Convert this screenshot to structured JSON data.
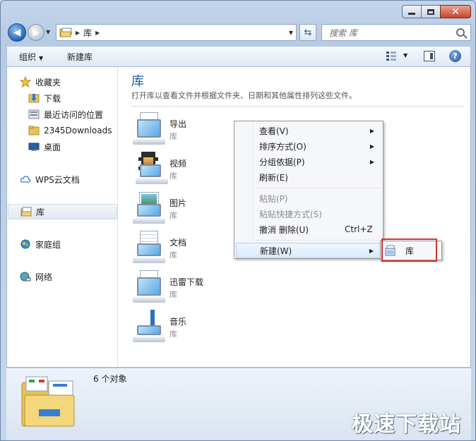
{
  "window": {
    "caption_buttons": [
      "minimize",
      "maximize",
      "close"
    ]
  },
  "navbar": {
    "address_path": [
      "库"
    ],
    "search_placeholder": "搜索 库"
  },
  "cmdbar": {
    "organize": "组织",
    "new_library": "新建库"
  },
  "navpane": {
    "favorites": "收藏夹",
    "downloads": "下载",
    "recent": "最近访问的位置",
    "downloads2345": "2345Downloads",
    "desktop": "桌面",
    "wps": "WPS云文档",
    "libraries": "库",
    "homegroup": "家庭组",
    "network": "网络"
  },
  "main": {
    "title": "库",
    "subtitle": "打开库以查看文件并根据文件夹、日期和其他属性排列这些文件。",
    "items": [
      {
        "name": "导出",
        "kind": "库",
        "icon": "monitor-icon"
      },
      {
        "name": "视频",
        "kind": "库",
        "icon": "video-icon"
      },
      {
        "name": "图片",
        "kind": "库",
        "icon": "pictures-icon"
      },
      {
        "name": "文档",
        "kind": "库",
        "icon": "documents-icon"
      },
      {
        "name": "迅雷下载",
        "kind": "库",
        "icon": "monitor-icon"
      },
      {
        "name": "音乐",
        "kind": "库",
        "icon": "music-icon"
      }
    ]
  },
  "context_menu": {
    "view": "查看(V)",
    "sort": "排序方式(O)",
    "group": "分组依据(P)",
    "refresh": "刷新(E)",
    "paste": "粘贴(P)",
    "paste_shortcut": "粘贴快捷方式(S)",
    "undo": "撤消 删除(U)",
    "undo_shortcut": "Ctrl+Z",
    "new": "新建(W)"
  },
  "submenu": {
    "library": "库"
  },
  "details": {
    "count": "6 个对象"
  },
  "watermark": "极速下载站"
}
